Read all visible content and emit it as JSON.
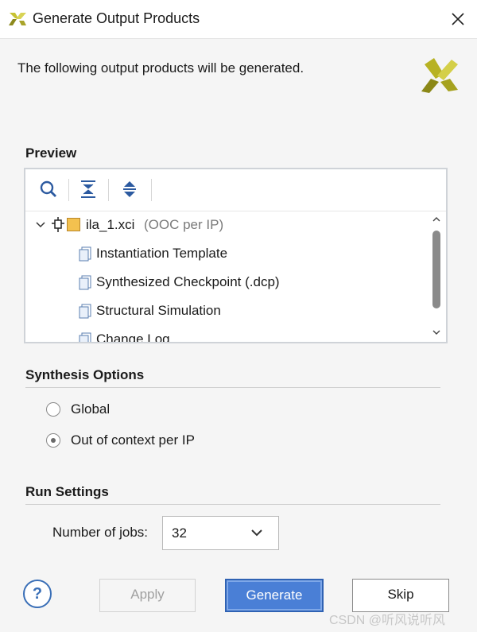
{
  "window": {
    "title": "Generate Output Products"
  },
  "intro_text": "The following output products will be generated.",
  "preview": {
    "section_title": "Preview",
    "toolbar": [
      "search-icon",
      "collapse-all-icon",
      "expand-all-icon"
    ],
    "tree": {
      "root_name": "ila_1.xci",
      "root_suffix": "(OOC per IP)",
      "items": [
        "Instantiation Template",
        "Synthesized Checkpoint (.dcp)",
        "Structural Simulation",
        "Change Log"
      ]
    }
  },
  "synthesis": {
    "section_title": "Synthesis Options",
    "options": [
      {
        "label": "Global",
        "selected": false
      },
      {
        "label": "Out of context per IP",
        "selected": true
      }
    ]
  },
  "run_settings": {
    "section_title": "Run Settings",
    "jobs_label": "Number of jobs:",
    "jobs_value": "32"
  },
  "buttons": {
    "help": "?",
    "apply": "Apply",
    "generate": "Generate",
    "skip": "Skip"
  },
  "watermark": "CSDN @听风说听风",
  "colors": {
    "accent": "#4a7fd6",
    "logo": "#b7b223"
  }
}
